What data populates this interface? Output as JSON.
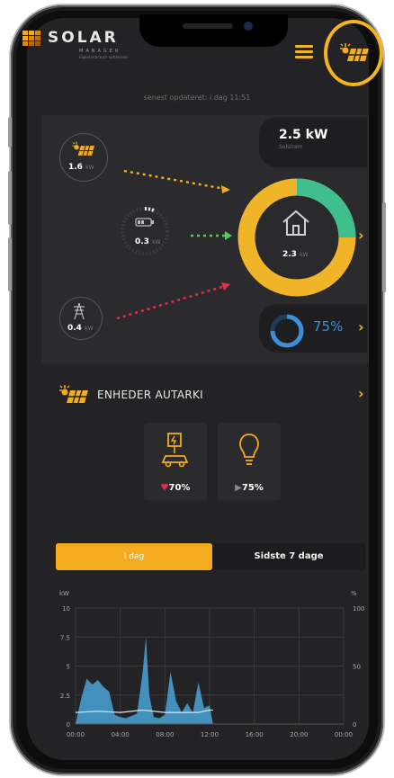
{
  "header": {
    "brand": "SOLAR",
    "brand_sub": "MANAGER",
    "brand_tagline": "Eigenverbrauch optimieren",
    "menu_icon": "hamburger-icon",
    "solar_icon": "solar-panel-sun-icon"
  },
  "status": {
    "updated": "senest opdateret: i dag 11:51"
  },
  "flow": {
    "solar": {
      "value": "1.6",
      "unit": "kW"
    },
    "battery": {
      "value": "0.3",
      "unit": "kW"
    },
    "grid": {
      "value": "0.4",
      "unit": "kW"
    },
    "home": {
      "value": "2.3",
      "unit": "kW"
    },
    "production": {
      "value": "2.5 kW",
      "label": "Solstrøm"
    },
    "autarky": "75%"
  },
  "devices": {
    "title": "ENHEDER AUTARKI",
    "items": [
      {
        "name": "ev-charger",
        "value": "70%"
      },
      {
        "name": "light-bulb",
        "value": "75%"
      }
    ]
  },
  "tabs": {
    "today": "I dag",
    "last7": "Sidste 7 dage"
  },
  "chart_data": {
    "type": "area",
    "title": "",
    "ylabel": "kW",
    "y2label": "%",
    "ylim": [
      0,
      10
    ],
    "y2lim": [
      0,
      100
    ],
    "yticks": [
      "10",
      "7.5",
      "5",
      "2.5",
      "0"
    ],
    "y2ticks": [
      "100",
      "50",
      "0"
    ],
    "xticks": [
      "00:00",
      "04:00",
      "08:00",
      "12:00",
      "16:00",
      "20:00",
      "00:00"
    ],
    "series": [
      {
        "values": [
          [
            0,
            0
          ],
          [
            0.5,
            2.2
          ],
          [
            1,
            3.9
          ],
          [
            1.5,
            3.4
          ],
          [
            2,
            3.8
          ],
          [
            2.5,
            3.2
          ],
          [
            3,
            2.8
          ],
          [
            3.5,
            0.8
          ],
          [
            4,
            0.6
          ],
          [
            4.5,
            0.5
          ],
          [
            5,
            0.7
          ],
          [
            5.5,
            0.9
          ],
          [
            6,
            4.4
          ],
          [
            6.3,
            7.5
          ],
          [
            6.6,
            2.5
          ],
          [
            7,
            0.6
          ],
          [
            7.5,
            0.5
          ],
          [
            8,
            0.8
          ],
          [
            8.5,
            4.5
          ],
          [
            9,
            2.0
          ],
          [
            9.5,
            1.0
          ],
          [
            10,
            1.8
          ],
          [
            10.5,
            1.0
          ],
          [
            11,
            3.6
          ],
          [
            11.5,
            1.4
          ],
          [
            12,
            1.6
          ],
          [
            12.3,
            0
          ]
        ]
      },
      {
        "values": [
          [
            0,
            1.0
          ],
          [
            2,
            1.1
          ],
          [
            4,
            1.0
          ],
          [
            6,
            1.2
          ],
          [
            8,
            1.0
          ],
          [
            10,
            1.0
          ],
          [
            11,
            1.0
          ],
          [
            12,
            1.2
          ],
          [
            12.3,
            1.2
          ]
        ]
      }
    ],
    "colors": {
      "consumption": "#4aa3d8",
      "solar": "#f5ab1e",
      "autarky": "#cfe6ff"
    }
  },
  "colors": {
    "accent": "#f5ab1e",
    "solar_arrow": "#f5ab1e",
    "battery_arrow": "#5cc864",
    "grid_arrow": "#e0314b",
    "home_ring_solar": "#f0b429",
    "home_ring_battery": "#3fbf8f",
    "autarky": "#3d8fd9",
    "background": "#232325"
  }
}
